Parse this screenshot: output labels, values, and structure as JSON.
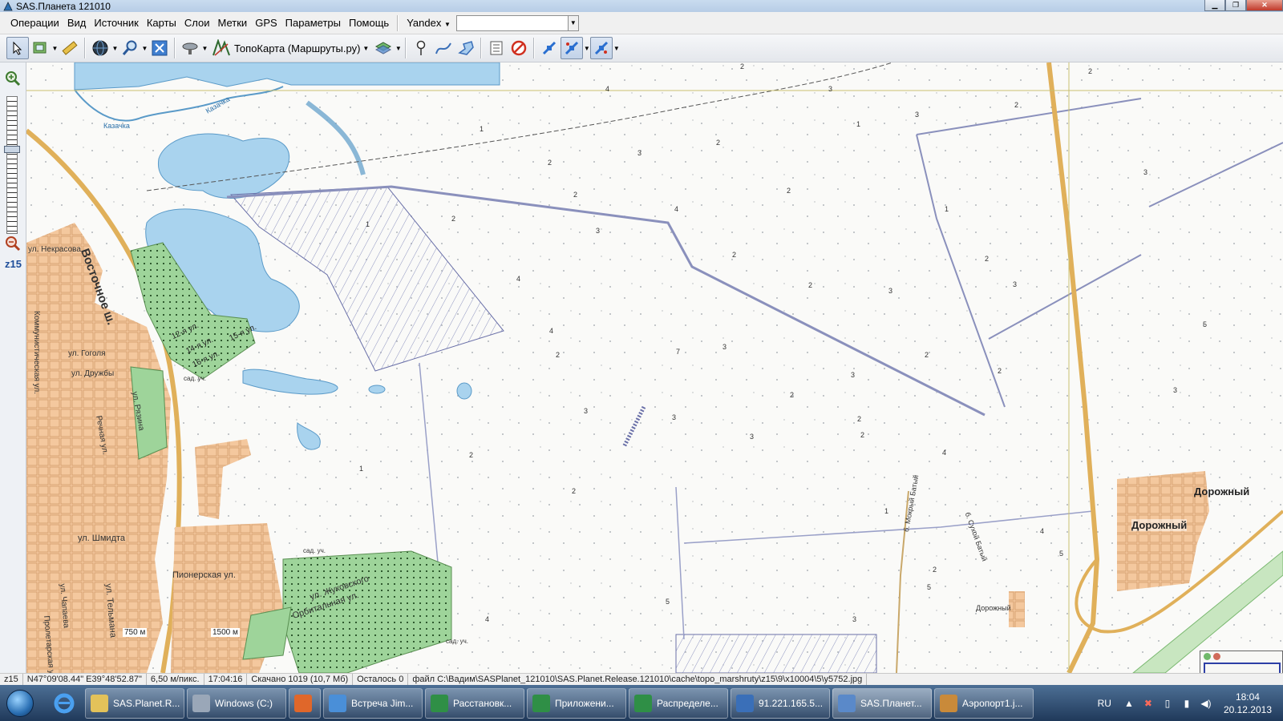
{
  "window": {
    "title": "SAS.Планета 121010"
  },
  "menu": {
    "items": [
      "Операции",
      "Вид",
      "Источник",
      "Карты",
      "Слои",
      "Метки",
      "GPS",
      "Параметры",
      "Помощь"
    ],
    "search_provider": "Yandex",
    "search_value": ""
  },
  "toolbar": {
    "map_source": "ТопоКарта (Маршруты.ру)"
  },
  "zoom": {
    "level_label": "z15"
  },
  "map": {
    "streets": [
      "Восточное ш.",
      "ул. Некрасова",
      "Коммунистическая ул.",
      "ул. Гоголя",
      "ул. Дружбы",
      "ул. Рязина",
      "Речная ул.",
      "ул. Шмидта",
      "Пионерская ул.",
      "ул. Жуковского",
      "Орбитальная ул.",
      "ул. Тельмана",
      "ул. Чапаева",
      "Пролетарская ул.",
      "12-я ул.",
      "14-я ул.",
      "15-я ул.",
      "16-я ул.",
      "Казачка"
    ],
    "places": [
      "Дорожный",
      "Дорожный"
    ],
    "small_labels": [
      "Казачка",
      "сад. уч.",
      "сад. уч.",
      "сад. уч.",
      "Дорожный",
      "б. Сухой Батый",
      "б. Мокрый Батый"
    ],
    "scale_labels": [
      "750 м",
      "1500 м"
    ],
    "spot_values": [
      "2",
      "3",
      "4",
      "1",
      "2",
      "3",
      "2",
      "2",
      "1",
      "3",
      "2",
      "2",
      "4",
      "1",
      "3",
      "2",
      "2",
      "3",
      "2",
      "4",
      "2",
      "3",
      "2",
      "3",
      "5",
      "3",
      "4",
      "2",
      "3",
      "2",
      "3",
      "2",
      "1",
      "3",
      "2",
      "2",
      "4",
      "5",
      "4",
      "5",
      "3",
      "2",
      "1",
      "7",
      "2",
      "3",
      "4",
      "5",
      "2",
      "1",
      "2",
      "3"
    ]
  },
  "status": {
    "zoom": "z15",
    "coords": "N47°09'08.44\" E39°48'52.87\"",
    "scale": "6,50 м/пикс.",
    "time": "17:04:16",
    "downloaded": "Скачано 1019 (10,7 Мб)",
    "remaining": "Осталось 0",
    "file": "файл C:\\Вадим\\SASPlanet_121010\\SAS.Planet.Release.121010\\cache\\topo_marshruty\\z15\\9\\x10004\\5\\y5752.jpg"
  },
  "taskbar": {
    "tasks": [
      {
        "label": "SAS.Planet.R...",
        "color": "#e3c25a"
      },
      {
        "label": "Windows (C:)",
        "color": "#9aa7b8"
      },
      {
        "label": "",
        "color": "#e0672a"
      },
      {
        "label": "Встреча Jim...",
        "color": "#4a8fd8"
      },
      {
        "label": "Расстановк...",
        "color": "#2f8f46"
      },
      {
        "label": "Приложени...",
        "color": "#2f8f46"
      },
      {
        "label": "Распределе...",
        "color": "#2f8f46"
      },
      {
        "label": "91.221.165.5...",
        "color": "#3a6fb8"
      },
      {
        "label": "SAS.Планет...",
        "color": "#5a89c9"
      },
      {
        "label": "Аэропорт1.j...",
        "color": "#c98a3a"
      }
    ],
    "lang": "RU",
    "time": "18:04",
    "date": "20.12.2013"
  },
  "colors": {
    "water": "#a9d3ee",
    "residential": "#f4c89e",
    "gardens": "#9ed49a",
    "highway": "#e0b05a",
    "road": "#9aa0c8"
  }
}
